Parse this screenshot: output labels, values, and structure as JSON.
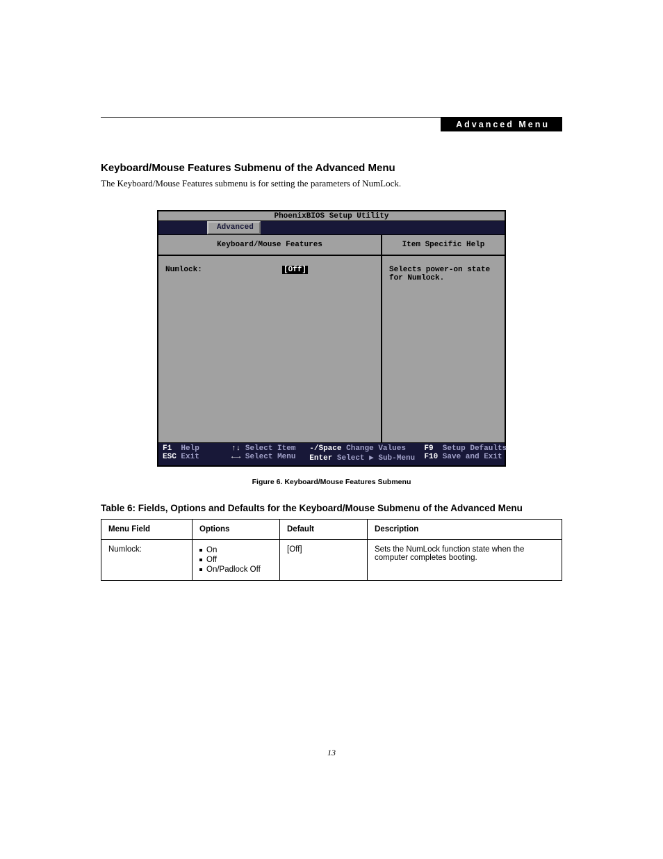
{
  "header_bar": "Advanced Menu",
  "section_title": "Keyboard/Mouse Features Submenu of the Advanced Menu",
  "intro": "The Keyboard/Mouse Features submenu is for setting the parameters of NumLock.",
  "bios": {
    "window_title": "PhoenixBIOS Setup Utility",
    "tab": "Advanced",
    "left_title": "Keyboard/Mouse Features",
    "right_title": "Item Specific Help",
    "field_label": "Numlock:",
    "field_value": "[Off]",
    "help_text": "Selects power-on state for Numlock.",
    "footer": {
      "f1": "F1",
      "f1l": "Help",
      "esc": "ESC",
      "escl": "Exit",
      "ud": "↑↓",
      "udl": "Select Item",
      "lr": "←→",
      "lrl": "Select Menu",
      "mp": "-/Space",
      "mpl": "Change Values",
      "en": "Enter",
      "enl": "Select ▶ Sub-Menu",
      "f9": "F9",
      "f9l": "Setup Defaults",
      "f10": "F10",
      "f10l": "Save and Exit"
    }
  },
  "figure_caption": "Figure 6.   Keyboard/Mouse Features Submenu",
  "table_title": "Table 6: Fields, Options and Defaults for the Keyboard/Mouse Submenu of the Advanced Menu",
  "table": {
    "head": {
      "c1": "Menu Field",
      "c2": "Options",
      "c3": "Default",
      "c4": "Description"
    },
    "row": {
      "menu": "Numlock:",
      "opt1": "On",
      "opt2": "Off",
      "opt3": "On/Padlock Off",
      "def": "[Off]",
      "desc": "Sets the NumLock function state when the computer completes booting."
    }
  },
  "page_number": "13"
}
